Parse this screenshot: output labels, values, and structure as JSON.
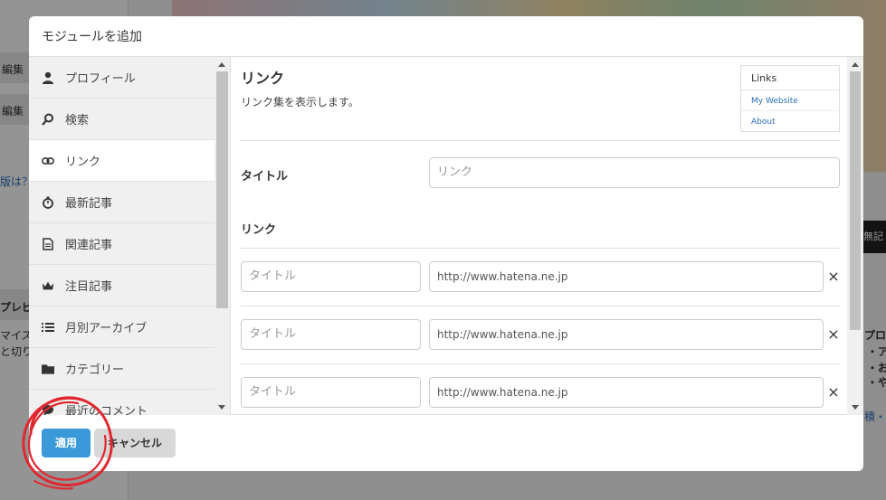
{
  "background": {
    "left_texts": [
      "編集",
      "編集",
      "版は？",
      "プレビ",
      "マイズ",
      "と切り"
    ],
    "right_texts": [
      "無記",
      "プロ",
      "・ア",
      "・お",
      "・や",
      "積・"
    ]
  },
  "modal": {
    "title": "モジュールを追加",
    "sidebar": {
      "items": [
        {
          "label": "プロフィール",
          "icon": "user-icon"
        },
        {
          "label": "検索",
          "icon": "search-icon"
        },
        {
          "label": "リンク",
          "icon": "link-icon"
        },
        {
          "label": "最新記事",
          "icon": "stopwatch-icon"
        },
        {
          "label": "関連記事",
          "icon": "document-icon"
        },
        {
          "label": "注目記事",
          "icon": "crown-icon"
        },
        {
          "label": "月別アーカイブ",
          "icon": "list-icon"
        },
        {
          "label": "カテゴリー",
          "icon": "folder-icon"
        },
        {
          "label": "最近のコメント",
          "icon": "comment-icon"
        }
      ],
      "active_index": 2
    },
    "content": {
      "title": "リンク",
      "description": "リンク集を表示します。",
      "preview": {
        "heading": "Links",
        "links": [
          "My Website",
          "About"
        ]
      },
      "title_label": "タイトル",
      "title_placeholder": "リンク",
      "links_label": "リンク",
      "link_rows": [
        {
          "title_placeholder": "タイトル",
          "url_placeholder": "http://www.hatena.ne.jp",
          "remove": "×"
        },
        {
          "title_placeholder": "タイトル",
          "url_placeholder": "http://www.hatena.ne.jp",
          "remove": "×"
        },
        {
          "title_placeholder": "タイトル",
          "url_placeholder": "http://www.hatena.ne.jp",
          "remove": "×"
        }
      ]
    },
    "footer": {
      "apply_label": "適用",
      "cancel_label": "キャンセル"
    }
  },
  "colors": {
    "primary": "#3a9ad9",
    "annotation_circle": "#e0272e"
  }
}
